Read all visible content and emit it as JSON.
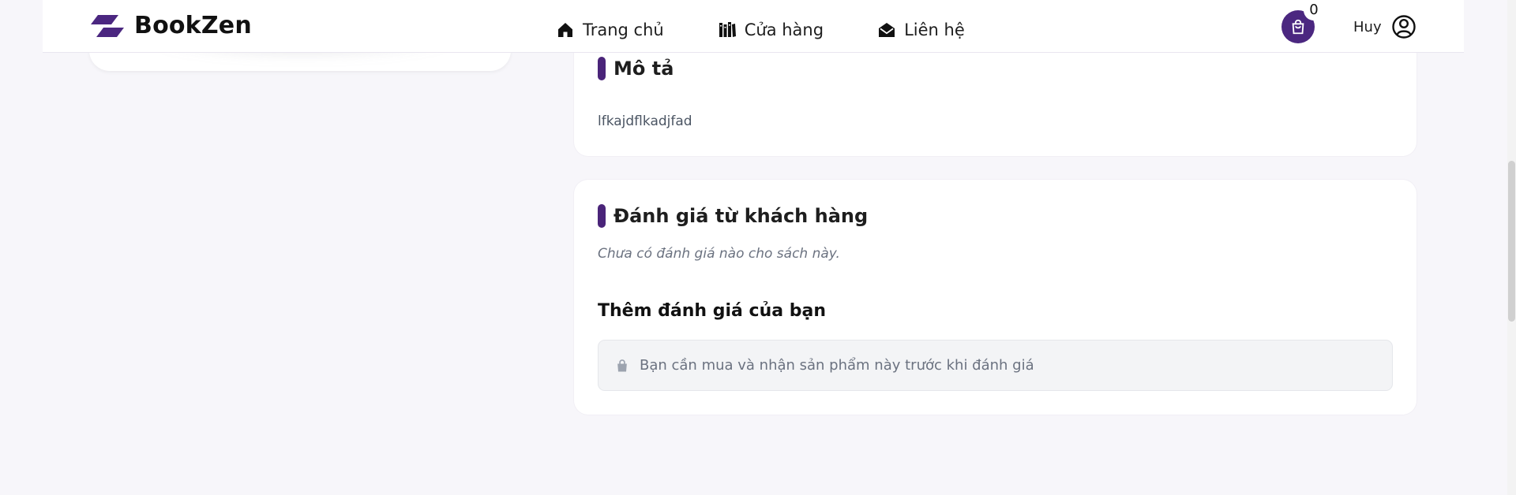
{
  "header": {
    "brand_name": "BookZen",
    "brand_icon": "bookzen-logo-icon",
    "nav": [
      {
        "label": "Trang chủ",
        "icon": "home-icon"
      },
      {
        "label": "Cửa hàng",
        "icon": "books-icon"
      },
      {
        "label": "Liên hệ",
        "icon": "mail-open-icon"
      }
    ],
    "cart": {
      "icon": "shopping-bag-icon",
      "count": "0"
    },
    "user": {
      "name": "Huy",
      "icon": "user-circle-icon"
    }
  },
  "description_section": {
    "title": "Mô tả",
    "text": "lfkajdflkadjfad"
  },
  "reviews_section": {
    "title": "Đánh giá từ khách hàng",
    "empty_text": "Chưa có đánh giá nào cho sách này.",
    "add_review_title": "Thêm đánh giá của bạn",
    "notice_text": "Bạn cần mua và nhận sản phẩm này trước khi đánh giá",
    "notice_icon": "shopping-bag-icon"
  },
  "colors": {
    "brand": "#4b2780",
    "page_background": "#f7f6fa",
    "card_background": "#ffffff",
    "muted_text": "#6b7280"
  }
}
